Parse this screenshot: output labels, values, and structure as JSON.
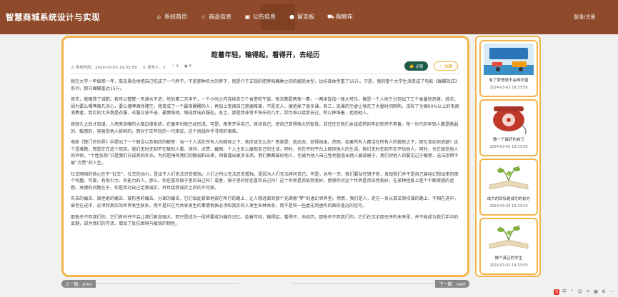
{
  "header": {
    "brand": "智慧商城系统设计与实现",
    "nav": [
      {
        "label": "系统首页",
        "icon": "home-icon",
        "glyph": "⌂"
      },
      {
        "label": "商品信息",
        "icon": "star-icon",
        "glyph": "☆"
      },
      {
        "label": "公告信息",
        "icon": "notice-icon",
        "glyph": "▣"
      },
      {
        "label": "留言板",
        "icon": "message-icon",
        "glyph": "●"
      },
      {
        "label": "购物车",
        "icon": "cart-icon",
        "glyph": "⛟"
      }
    ],
    "login": "登录/注册"
  },
  "article": {
    "title": "趁着年轻，输得起，看得开，去经历",
    "meta": {
      "date": "发布时间：2024-03-03 19:33:59",
      "author": "发布人：1",
      "likes": "1",
      "views": "0"
    },
    "like_label": "点赞",
    "collect_label": "收藏",
    "paragraphs": [
      "我在大学一年级那一年，毫无悬念地把自己吃成了一个胖子。不是那种巨大的胖子，而是介于正规的肥胖和臃肿之间的尴尬体型，比标准体型重了15斤。于是，我的整个大学生活变成了电影《蝴蝶效应》系列，那只蝴蝶重达15斤。",
      "首先，我眼馋了减肥。我可以整整一天滴水不进，然后第二天中午，一个小时之内连续去三个食堂吃午饭，每次都是两荤一素，一两米饭加一瓶大可乐，像是一个人拖千分到出了三个食量惊恐者。其次，因为要么喝啤酒凡凉心，要么撞啤酒徐瑾空，我变成了一个最夜醒醒的人，再加上宽阔自己遮遍难黄，不愿见人，便逃掉了很多课。其三，逃课的空虚让我花了大量时间网购，击败了全国90%以上的电商消费者，我买的大多数是衣服，衣服又穿不进，最懊恼地，缩成胖瑞衣服处。总之，那是我非常不快乐的几年。因为难以接受自己，所以摔堆着，拒绝他人。",
      "我很久之后才知道，人用来自嘲的大脑边缘系统，在童年时就已经形成。可是，用来开导自己、原谅自己、使自己变得强大的智慧，却往往在我们本该成熟的年纪依然不具备。每一世代的年轻人都是脆弱的、敏感的、容易受他人影响的，而对于正年轻的一代来说，这个挑战异乎寻常的艰难。",
      "电影《楚门的世界》中提出了一个假设以及相应的解答：当一个人活在所有人的窥探之下，他应该怎么办？答案是：逃出去，获得自由。然而，如果所有人都活在所有人的窥探之下，那又该如何逃避？这个是难题，而是正在这个现实。我们无时无刻不在被别人看、询问、点赞、截图，个人主页上展现自己的生活，同时，也在评判平台上窥探他人的生活，我们无时无刻不在评估他人，同时，也在接受他人的评估。“个性张扬”只是我们向成熟的外衣，为的是掩饰我们的脆弱和自卑，但暴露出更多东西，我们集都被好他人，也被为他人自己性地营造出他人展幕展于。我们对他人的要见过于敏感，无法恐惧不被“点赞”的人生。",
      "社交网络的核心在于“社交”，社交的动力，是出于人们无法忍受孤独，人们之所以无法忍受孤独，是因为人们无法拷问自己。可是，总有一天，我们要站在镜子前，发现我们并不是自己曾经幻想出来的那个有趣、可爱、有吸引力、有能力的人。那么，你还喜欢镜子里的自己吗？或者，镜子里的你还喜欢自己吗？这个世界是否依然美好，感恩你对这个世界是否依然美好，在某种程度上是个不断揉搓的话题。关键的问题在于，你是否对自己足够诚实，并且接受诚实之后的不完美。",
      "失去的痛苦、被拒绝的痛苦、被伤害的痛苦、分离的痛苦，它们如此紧密地嵌在所行的路上，让人想逃离到那个充满着“梦”的虚幻世界里。然而，我们是人，走在一条从孤苦到坎薄的路上，不相在进中，衰老在进中，必须和真实的世界发生联系，而不是只在为共享发生的事情悦佩必须和真实的人发生各种关系，而不是和一些虚无到虚构的图形遥远的信号。",
      "那些杀不死我们的，它们有时并不会让我们更加强大，而只是成为一段将要成为痛的记忆。趁着年轻，输得起，看得开，去经历。那些杀不死我们的，它们在沉沦而无序的未来里，并不能成为我们手中的武器，却为我们的存活，增加了反抗困境与敏锐的韧性。"
    ]
  },
  "pager": {
    "prev": "上一篇：prev",
    "next": "下一篇：next"
  },
  "sidebar": {
    "items": [
      {
        "title": "有了梦想就不会再彷徨",
        "date": "2024-03-03 19:33:59"
      },
      {
        "title": "做一个最好的自己",
        "date": "2024-03-03 19:33:59"
      },
      {
        "title": "成大的目标是成功的前方",
        "date": "2024-03-03 19:33:59"
      },
      {
        "title": "做个真正的学生",
        "date": "2024-03-03 19:33:59"
      }
    ]
  },
  "tray": {
    "items": [
      "中",
      "°",
      "☺",
      "✎",
      "▦",
      "⚙",
      "⋯"
    ]
  },
  "colors": {
    "header_bg": "#8e4a2a",
    "accent": "#f3b44b",
    "like_bg": "#1d5b4a"
  }
}
